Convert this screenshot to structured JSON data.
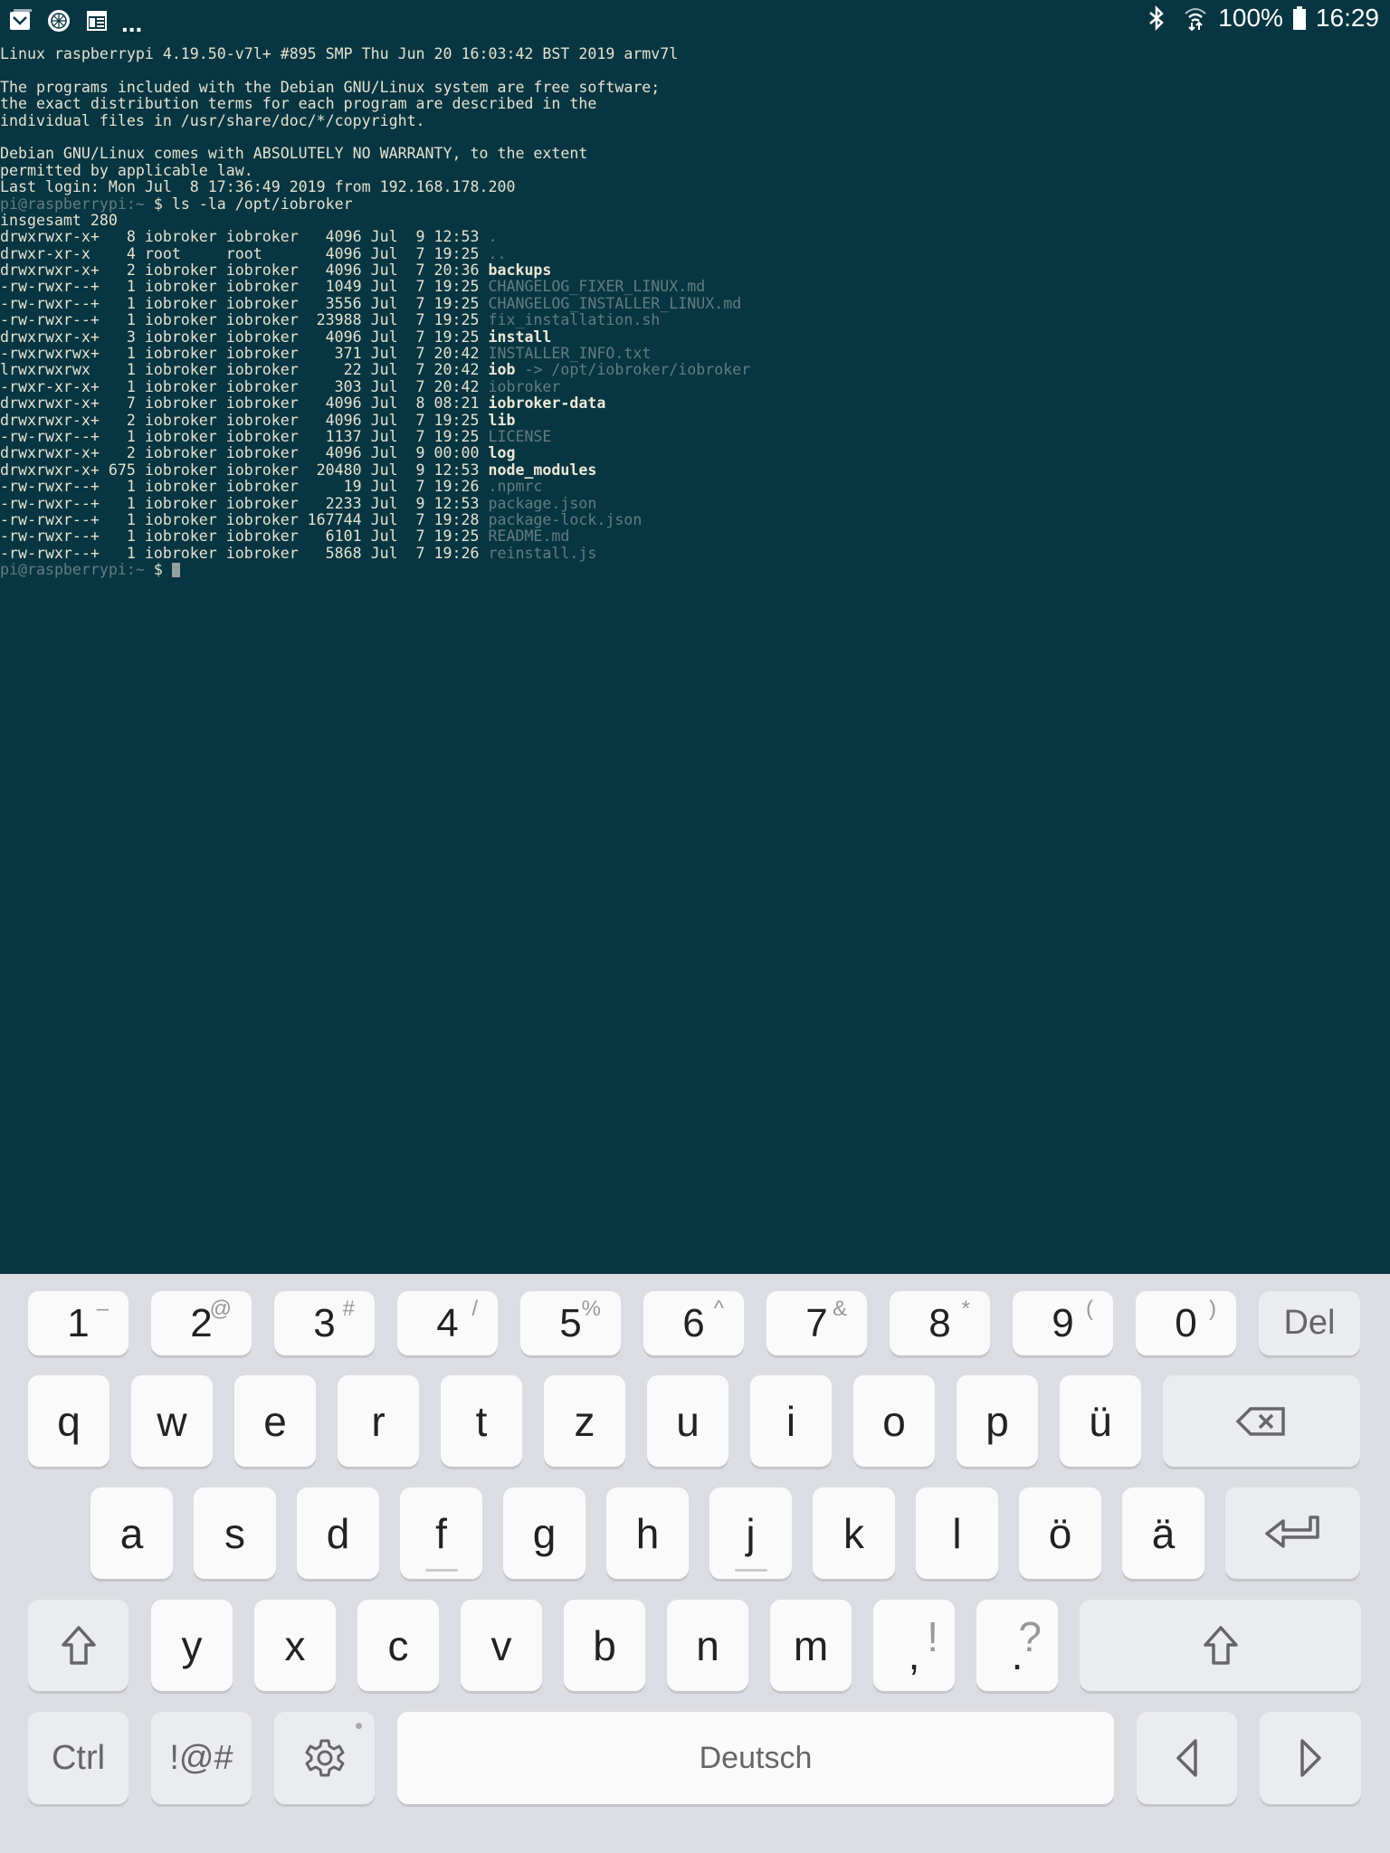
{
  "status_bar": {
    "left_icons": [
      "mail-icon",
      "app-icon",
      "calendar-icon"
    ],
    "more": "...",
    "battery": "100%",
    "time": "16:29"
  },
  "terminal": {
    "motd": [
      "Linux raspberrypi 4.19.50-v7l+ #895 SMP Thu Jun 20 16:03:42 BST 2019 armv7l",
      "",
      "The programs included with the Debian GNU/Linux system are free software;",
      "the exact distribution terms for each program are described in the",
      "individual files in /usr/share/doc/*/copyright.",
      "",
      "Debian GNU/Linux comes with ABSOLUTELY NO WARRANTY, to the extent",
      "permitted by applicable law.",
      "Last login: Mon Jul  8 17:36:49 2019 from 192.168.178.200"
    ],
    "prompt": "pi@raspberrypi:~ ",
    "command": "$ ls -la /opt/iobroker",
    "total": "insgesamt 280",
    "listing": [
      {
        "info": "drwxrwxr-x+   8 iobroker iobroker   4096 Jul  9 12:53 ",
        "name": ".",
        "type": "file"
      },
      {
        "info": "drwxr-xr-x    4 root     root       4096 Jul  7 19:25 ",
        "name": "..",
        "type": "file"
      },
      {
        "info": "drwxrwxr-x+   2 iobroker iobroker   4096 Jul  7 20:36 ",
        "name": "backups",
        "type": "dir"
      },
      {
        "info": "-rw-rwxr--+   1 iobroker iobroker   1049 Jul  7 19:25 ",
        "name": "CHANGELOG_FIXER_LINUX.md",
        "type": "file"
      },
      {
        "info": "-rw-rwxr--+   1 iobroker iobroker   3556 Jul  7 19:25 ",
        "name": "CHANGELOG_INSTALLER_LINUX.md",
        "type": "file"
      },
      {
        "info": "-rw-rwxr--+   1 iobroker iobroker  23988 Jul  7 19:25 ",
        "name": "fix_installation.sh",
        "type": "file"
      },
      {
        "info": "drwxrwxr-x+   3 iobroker iobroker   4096 Jul  7 19:25 ",
        "name": "install",
        "type": "dir"
      },
      {
        "info": "-rwxrwxrwx+   1 iobroker iobroker    371 Jul  7 20:42 ",
        "name": "INSTALLER_INFO.txt",
        "type": "file"
      },
      {
        "info": "lrwxrwxrwx    1 iobroker iobroker     22 Jul  7 20:42 ",
        "name": "iob",
        "type": "link",
        "target": " -> /opt/iobroker/iobroker"
      },
      {
        "info": "-rwxr-xr-x+   1 iobroker iobroker    303 Jul  7 20:42 ",
        "name": "iobroker",
        "type": "file"
      },
      {
        "info": "drwxrwxr-x+   7 iobroker iobroker   4096 Jul  8 08:21 ",
        "name": "iobroker-data",
        "type": "dir"
      },
      {
        "info": "drwxrwxr-x+   2 iobroker iobroker   4096 Jul  7 19:25 ",
        "name": "lib",
        "type": "dir"
      },
      {
        "info": "-rw-rwxr--+   1 iobroker iobroker   1137 Jul  7 19:25 ",
        "name": "LICENSE",
        "type": "file"
      },
      {
        "info": "drwxrwxr-x+   2 iobroker iobroker   4096 Jul  9 00:00 ",
        "name": "log",
        "type": "dir"
      },
      {
        "info": "drwxrwxr-x+ 675 iobroker iobroker  20480 Jul  9 12:53 ",
        "name": "node_modules",
        "type": "dir"
      },
      {
        "info": "-rw-rwxr--+   1 iobroker iobroker     19 Jul  7 19:26 ",
        "name": ".npmrc",
        "type": "file"
      },
      {
        "info": "-rw-rwxr--+   1 iobroker iobroker   2233 Jul  9 12:53 ",
        "name": "package.json",
        "type": "file"
      },
      {
        "info": "-rw-rwxr--+   1 iobroker iobroker 167744 Jul  7 19:28 ",
        "name": "package-lock.json",
        "type": "file"
      },
      {
        "info": "-rw-rwxr--+   1 iobroker iobroker   6101 Jul  7 19:25 ",
        "name": "README.md",
        "type": "file"
      },
      {
        "info": "-rw-rwxr--+   1 iobroker iobroker   5868 Jul  7 19:26 ",
        "name": "reinstall.js",
        "type": "file"
      }
    ],
    "final_prompt": "pi@raspberrypi:~ ",
    "final_prompt_symbol": "$ "
  },
  "keyboard": {
    "row1": [
      {
        "main": "1",
        "sec": "–"
      },
      {
        "main": "2",
        "sec": "@"
      },
      {
        "main": "3",
        "sec": "#"
      },
      {
        "main": "4",
        "sec": "/"
      },
      {
        "main": "5",
        "sec": "%"
      },
      {
        "main": "6",
        "sec": "^"
      },
      {
        "main": "7",
        "sec": "&"
      },
      {
        "main": "8",
        "sec": "*"
      },
      {
        "main": "9",
        "sec": "("
      },
      {
        "main": "0",
        "sec": ")"
      }
    ],
    "del_label": "Del",
    "row2": [
      "q",
      "w",
      "e",
      "r",
      "t",
      "z",
      "u",
      "i",
      "o",
      "p",
      "ü"
    ],
    "row3": [
      "a",
      "s",
      "d",
      "f",
      "g",
      "h",
      "j",
      "k",
      "l",
      "ö",
      "ä"
    ],
    "row4": [
      {
        "main": "y"
      },
      {
        "main": "x"
      },
      {
        "main": "c"
      },
      {
        "main": "v"
      },
      {
        "main": "b"
      },
      {
        "main": "n"
      },
      {
        "main": "m"
      },
      {
        "main": ",",
        "sec": "!"
      },
      {
        "main": ".",
        "sec": "?"
      }
    ],
    "ctrl_label": "Ctrl",
    "symbols_label": "!@#",
    "space_label": "Deutsch"
  }
}
